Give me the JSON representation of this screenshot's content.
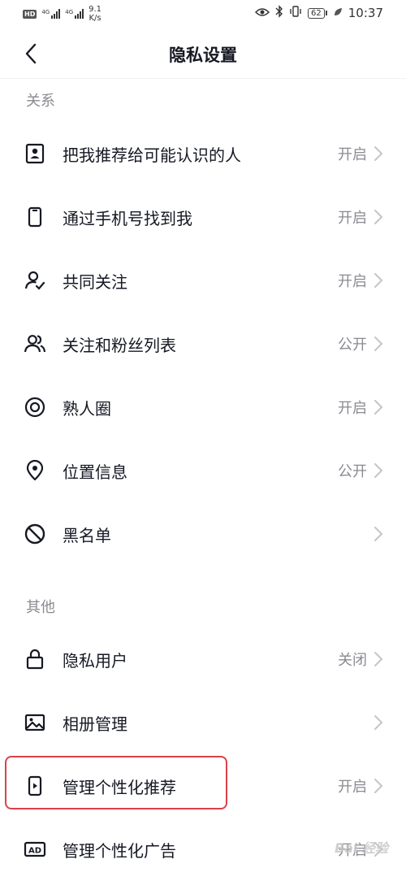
{
  "status_bar": {
    "hd": "HD",
    "signal1": "4G",
    "signal2": "4G",
    "net_speed_value": "9.1",
    "net_speed_unit": "K/s",
    "battery": "62",
    "time": "10:37"
  },
  "header": {
    "title": "隐私设置"
  },
  "sections": {
    "relations": {
      "title": "关系",
      "items": [
        {
          "label": "把我推荐给可能认识的人",
          "value": "开启",
          "icon": "contact-card-icon"
        },
        {
          "label": "通过手机号找到我",
          "value": "开启",
          "icon": "phone-icon"
        },
        {
          "label": "共同关注",
          "value": "开启",
          "icon": "user-check-icon"
        },
        {
          "label": "关注和粉丝列表",
          "value": "公开",
          "icon": "users-icon"
        },
        {
          "label": "熟人圈",
          "value": "开启",
          "icon": "circle-target-icon"
        },
        {
          "label": "位置信息",
          "value": "公开",
          "icon": "location-pin-icon"
        },
        {
          "label": "黑名单",
          "value": "",
          "icon": "block-icon"
        }
      ]
    },
    "other": {
      "title": "其他",
      "items": [
        {
          "label": "隐私用户",
          "value": "关闭",
          "icon": "lock-icon"
        },
        {
          "label": "相册管理",
          "value": "",
          "icon": "image-icon"
        },
        {
          "label": "管理个性化推荐",
          "value": "开启",
          "icon": "phone-play-icon"
        },
        {
          "label": "管理个性化广告",
          "value": "开启",
          "icon": "ad-icon"
        }
      ]
    }
  },
  "icon_labels": {
    "ad": "AD"
  },
  "watermark": "Bai 经验",
  "colors": {
    "text_primary": "#161823",
    "text_secondary": "#8a8b91",
    "highlight": "#d9424a"
  }
}
